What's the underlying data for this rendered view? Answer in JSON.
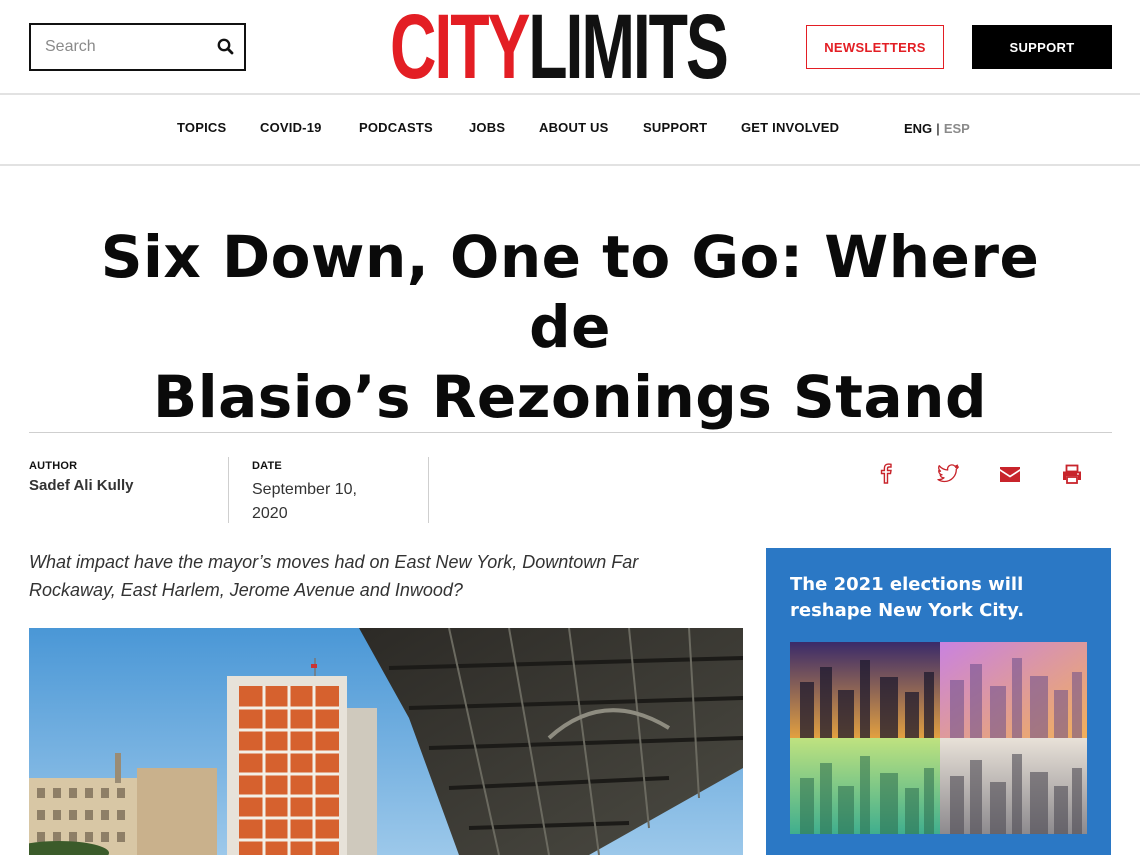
{
  "header": {
    "search_placeholder": "Search",
    "logo_city": "CITY",
    "logo_limits": "LIMITS",
    "newsletters_label": "NEWSLETTERS",
    "support_label": "SUPPORT"
  },
  "nav": {
    "items": [
      {
        "label": "TOPICS"
      },
      {
        "label": "COVID-19"
      },
      {
        "label": "PODCASTS"
      },
      {
        "label": "JOBS"
      },
      {
        "label": "ABOUT US"
      },
      {
        "label": "SUPPORT"
      },
      {
        "label": "GET INVOLVED"
      }
    ],
    "lang_eng": "ENG",
    "lang_sep": "|",
    "lang_esp": "ESP"
  },
  "article": {
    "headline_line1": "Six Down, One to Go: Where de",
    "headline_line2": "Blasio’s Rezonings Stand",
    "author_label": "AUTHOR",
    "author": "Sadef Ali Kully",
    "date_label": "DATE",
    "date": "September 10, 2020",
    "dek": "What impact have the mayor’s moves had on East New York, Downtown Far Rockaway, East Harlem, Jerome Avenue and Inwood?"
  },
  "share": {
    "icons": [
      "facebook-icon",
      "twitter-icon",
      "email-icon",
      "print-icon"
    ]
  },
  "promo": {
    "text": "The 2021 elections will reshape New York City."
  },
  "colors": {
    "brand_red": "#e31e24",
    "promo_blue": "#2b78c5",
    "icon_red": "#c8242b"
  }
}
